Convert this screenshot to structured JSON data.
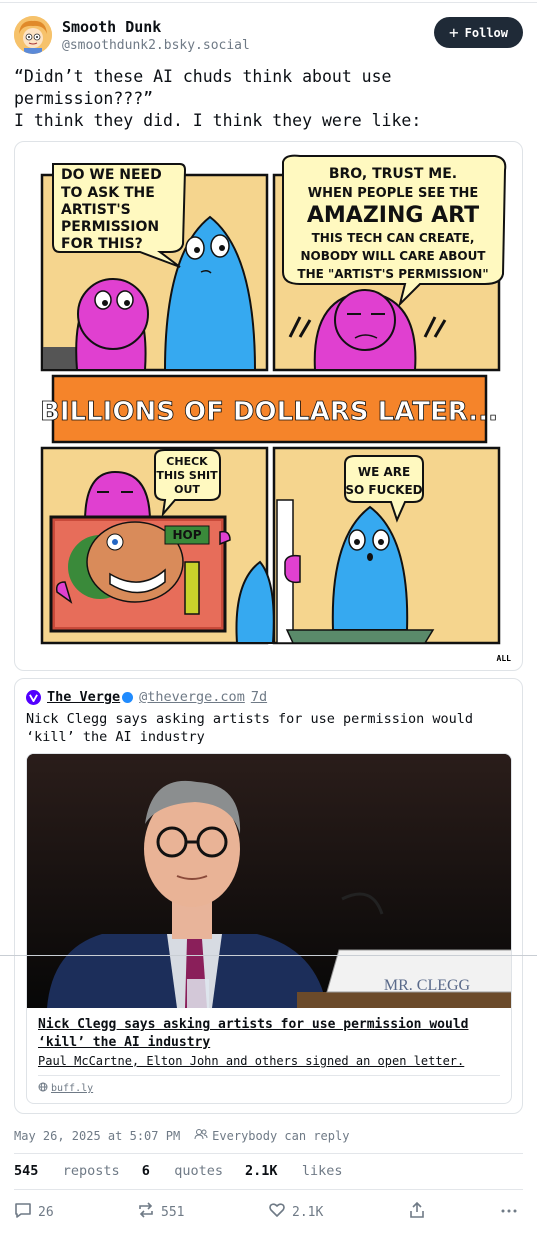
{
  "author": {
    "name": "Smooth Dunk",
    "handle": "@smoothdunk2.bsky.social",
    "follow_label": "Follow"
  },
  "post": {
    "text": "“Didn’t these AI chuds think about use\npermission???”\nI think they did. I think they were like:"
  },
  "comic": {
    "panel1_bubble": [
      "DO WE NEED",
      "TO ASK THE",
      "ARTIST'S",
      "PERMISSION",
      "FOR THIS?"
    ],
    "panel2_bubble": [
      "BRO, TRUST ME.",
      "WHEN PEOPLE SEE THE",
      "AMAZING ART",
      "THIS TECH CAN CREATE,",
      "NOBODY WILL CARE ABOUT",
      "THE \"ARTIST'S PERMISSION\""
    ],
    "banner": "BILLIONS OF DOLLARS LATER...",
    "panel3_bubble": [
      "CHECK",
      "THIS SHIT",
      "OUT"
    ],
    "panel3_art_text": "HOP",
    "panel4_bubble": [
      "WE ARE",
      "SO FUCKED"
    ],
    "alt_badge": "ALL"
  },
  "quote": {
    "source_name": "The Verge",
    "source_handle": "@theverge.com",
    "age": "7d",
    "text": "Nick Clegg says asking artists for use permission would ‘kill’ the AI industry",
    "card": {
      "placard": "MR. CLEGG",
      "title": "Nick Clegg says asking artists for use permission would ‘kill’ the AI industry",
      "description": "Paul McCartne, Elton John and others signed an open letter.",
      "domain": "buff.ly"
    }
  },
  "meta": {
    "timestamp": "May 26, 2025 at 5:07 PM",
    "reply_setting": "Everybody can reply"
  },
  "stats": {
    "reposts_count": "545",
    "reposts_label": "reposts",
    "quotes_count": "6",
    "quotes_label": "quotes",
    "likes_count": "2.1K",
    "likes_label": "likes"
  },
  "actions": {
    "replies": "26",
    "reposts": "551",
    "likes": "2.1K"
  },
  "colors": {
    "follow_bg": "#1f2a37",
    "comic_bg": "#f5d58e",
    "banner": "#f5842a",
    "magenta_character": "#e040d0",
    "blue_character": "#36a9f0",
    "verge_purple": "#5200ff",
    "verified_blue": "#208bfe"
  }
}
